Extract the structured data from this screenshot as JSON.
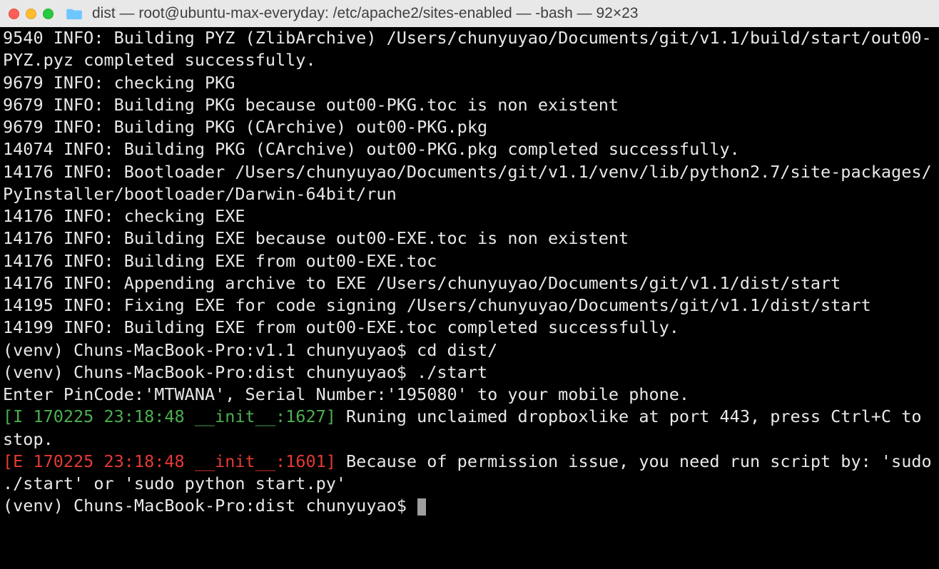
{
  "window": {
    "title": "dist — root@ubuntu-max-everyday: /etc/apache2/sites-enabled — -bash — 92×23"
  },
  "terminal": {
    "lines": [
      {
        "text": "9540 INFO: Building PYZ (ZlibArchive) /Users/chunyuyao/Documents/git/v1.1/build/start/out00-PYZ.pyz completed successfully.",
        "cls": ""
      },
      {
        "text": "9679 INFO: checking PKG",
        "cls": ""
      },
      {
        "text": "9679 INFO: Building PKG because out00-PKG.toc is non existent",
        "cls": ""
      },
      {
        "text": "9679 INFO: Building PKG (CArchive) out00-PKG.pkg",
        "cls": ""
      },
      {
        "text": "14074 INFO: Building PKG (CArchive) out00-PKG.pkg completed successfully.",
        "cls": ""
      },
      {
        "text": "14176 INFO: Bootloader /Users/chunyuyao/Documents/git/v1.1/venv/lib/python2.7/site-packages/PyInstaller/bootloader/Darwin-64bit/run",
        "cls": ""
      },
      {
        "text": "14176 INFO: checking EXE",
        "cls": ""
      },
      {
        "text": "14176 INFO: Building EXE because out00-EXE.toc is non existent",
        "cls": ""
      },
      {
        "text": "14176 INFO: Building EXE from out00-EXE.toc",
        "cls": ""
      },
      {
        "text": "14176 INFO: Appending archive to EXE /Users/chunyuyao/Documents/git/v1.1/dist/start",
        "cls": ""
      },
      {
        "text": "14195 INFO: Fixing EXE for code signing /Users/chunyuyao/Documents/git/v1.1/dist/start",
        "cls": ""
      },
      {
        "text": "14199 INFO: Building EXE from out00-EXE.toc completed successfully.",
        "cls": ""
      },
      {
        "text": "(venv) Chuns-MacBook-Pro:v1.1 chunyuyao$ cd dist/",
        "cls": ""
      },
      {
        "text": "(venv) Chuns-MacBook-Pro:dist chunyuyao$ ./start",
        "cls": ""
      },
      {
        "text": "Enter PinCode:'MTWANA', Serial Number:'195080' to your mobile phone.",
        "cls": ""
      },
      {
        "text": "",
        "cls": ""
      },
      {
        "prefix": "[I 170225 23:18:48 __init__:1627]",
        "rest": " Runing unclaimed dropboxlike at port 443, press Ctrl+C to stop.",
        "cls": "log-info-green"
      },
      {
        "prefix": "[E 170225 23:18:48 __init__:1601]",
        "rest": " Because of permission issue, you need run script by: 'sudo ./start' or 'sudo python start.py'",
        "cls": "log-error-red"
      }
    ],
    "prompt": "(venv) Chuns-MacBook-Pro:dist chunyuyao$ "
  }
}
